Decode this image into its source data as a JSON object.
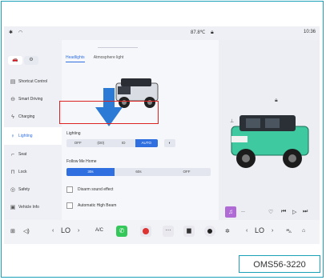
{
  "status_bar": {
    "temp": "87.8℃",
    "time": "10:36"
  },
  "side_tabs": [
    "🚗",
    "⚙"
  ],
  "sidebar": {
    "items": [
      {
        "label": "Shortcut Control",
        "icon": "shortcut-icon"
      },
      {
        "label": "Smart Driving",
        "icon": "steering-icon"
      },
      {
        "label": "Charging",
        "icon": "charging-icon"
      },
      {
        "label": "Lighting",
        "icon": "lightbulb-icon",
        "active": true
      },
      {
        "label": "Seat",
        "icon": "seat-icon"
      },
      {
        "label": "Lock",
        "icon": "lock-icon"
      },
      {
        "label": "Safety",
        "icon": "safety-icon"
      },
      {
        "label": "Vehicle Info",
        "icon": "info-icon"
      }
    ]
  },
  "main": {
    "tabs": [
      {
        "label": "Headlights",
        "active": true
      },
      {
        "label": "Atmosphere light",
        "active": false
      }
    ],
    "lighting_label": "Lighting",
    "lighting_options": [
      "OFF",
      "(D0)",
      "ID",
      "AUTO"
    ],
    "lighting_selected": "AUTO",
    "follow_label": "Follow Me Home",
    "follow_options": [
      "30s",
      "60s",
      "OFF"
    ],
    "follow_selected": "30s",
    "disarm_label": "Disarm sound effect",
    "high_beam_label": "Automatic High Beam"
  },
  "media": {
    "title": "---"
  },
  "bottom_bar": {
    "left_temp": "LO",
    "ac_label": "A/C",
    "right_temp": "LO"
  },
  "watermark": "OMS56-3220",
  "colors": {
    "accent": "#2f6fe0",
    "highlight_border": "#dd2222",
    "frame": "#1aa0b8"
  }
}
